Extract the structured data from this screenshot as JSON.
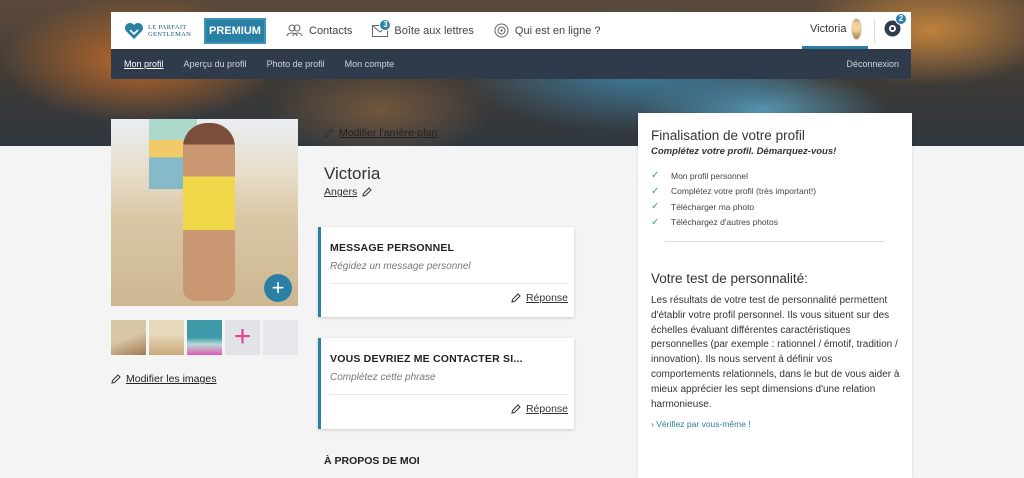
{
  "brand": {
    "logo_line1": "LE PARFAIT",
    "logo_line2": "GENTLEMAN",
    "accent": "#2a7fa5"
  },
  "topnav": {
    "premium_label": "PREMIUM",
    "contacts_label": "Contacts",
    "mailbox_label": "Boîte aux lettres",
    "mailbox_badge": "3",
    "online_label": "Qui est en ligne ?",
    "user_name": "Victoria",
    "notif_badge": "2"
  },
  "subnav": {
    "items": [
      "Mon profil",
      "Aperçu du profil",
      "Photo de profil",
      "Mon compte"
    ],
    "logout": "Déconnexion"
  },
  "left": {
    "edit_images": "Modifier les images"
  },
  "middle": {
    "edit_background": "Modifier l'arrière-plan",
    "name": "Victoria",
    "city": "Angers",
    "cards": [
      {
        "title": "MESSAGE PERSONNEL",
        "subtitle": "Régidez un message personnel",
        "reply": "Réponse"
      },
      {
        "title": "VOUS DEVRIEZ ME CONTACTER SI...",
        "subtitle": "Complétez cette phrase",
        "reply": "Réponse"
      }
    ],
    "about_title": "À PROPOS DE MOI"
  },
  "right": {
    "title": "Finalisation de votre profil",
    "subtitle": "Complétez votre profil. Démarquez-vous!",
    "checklist": [
      "Mon profil personnel",
      "Complétez votre profil (très important!)",
      "Télécharger ma photo",
      "Téléchargez d'autres photos"
    ],
    "test_title": "Votre test de personnalité:",
    "test_text": "Les résultats de votre test de personnalité permettent d'établir votre profil personnel. Ils vous situent sur des échelles évaluant différentes caractéristiques personnelles (par exemple : rationnel / émotif, tradition / innovation). Ils nous servent à définir vos comportements relationnels, dans le but de vous aider à mieux apprécier les sept dimensions d'une relation harmonieuse.",
    "test_link": "Vérifiez par vous-même !"
  }
}
